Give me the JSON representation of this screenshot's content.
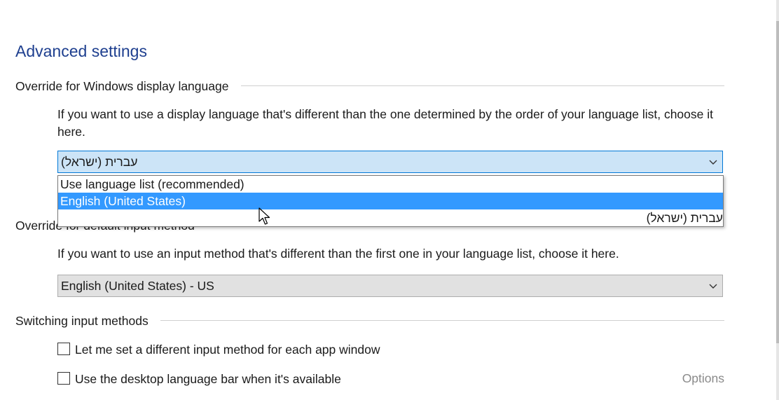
{
  "page": {
    "title": "Advanced settings"
  },
  "display_language": {
    "header": "Override for Windows display language",
    "description": "If you want to use a display language that's different than the one determined by the order of your language list, choose it here.",
    "selected_value": "עברית (ישראל)",
    "options": [
      {
        "label": "Use language list (recommended)",
        "selected": false
      },
      {
        "label": "English (United States)",
        "selected": true
      },
      {
        "label": "עברית (ישראל)",
        "selected": false
      }
    ]
  },
  "input_method": {
    "header": "Override for default input method",
    "description": "If you want to use an input method that's different than the first one in your language list, choose it here.",
    "selected_value": "English (United States) - US"
  },
  "switching": {
    "header": "Switching input methods",
    "checkbox1_label": "Let me set a different input method for each app window",
    "checkbox1_checked": false,
    "checkbox2_label": "Use the desktop language bar when it's available",
    "checkbox2_checked": false,
    "options_label": "Options"
  },
  "colors": {
    "accent": "#1e3f8f",
    "selection": "#3399ff",
    "open_select_bg": "#cce4f7",
    "disabled_text": "#8a8a8a"
  },
  "icons": {
    "chevron": "chevron-down-icon",
    "cursor": "mouse-pointer-icon"
  }
}
